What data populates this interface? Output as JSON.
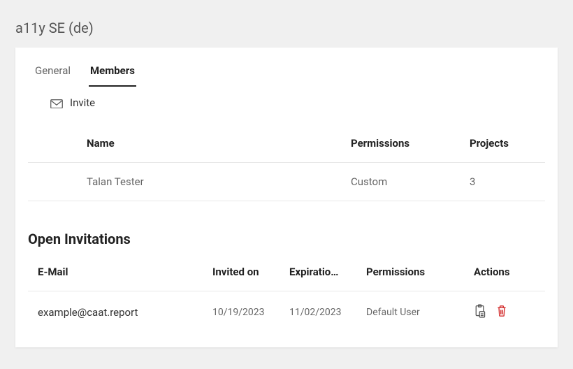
{
  "page_title": "a11y SE (de)",
  "tabs": [
    {
      "label": "General",
      "active": false
    },
    {
      "label": "Members",
      "active": true
    }
  ],
  "invite": {
    "label": "Invite"
  },
  "members_table": {
    "headers": {
      "name": "Name",
      "permissions": "Permissions",
      "projects": "Projects"
    },
    "rows": [
      {
        "name": "Talan Tester",
        "permissions": "Custom",
        "projects": "3"
      }
    ]
  },
  "invitations": {
    "title": "Open Invitations",
    "headers": {
      "email": "E-Mail",
      "invited_on": "Invited on",
      "expiration": "Expiratio…",
      "permissions": "Permissions",
      "actions": "Actions"
    },
    "rows": [
      {
        "email": "example@caat.report",
        "invited_on": "10/19/2023",
        "expiration": "11/02/2023",
        "permissions": "Default User"
      }
    ]
  }
}
